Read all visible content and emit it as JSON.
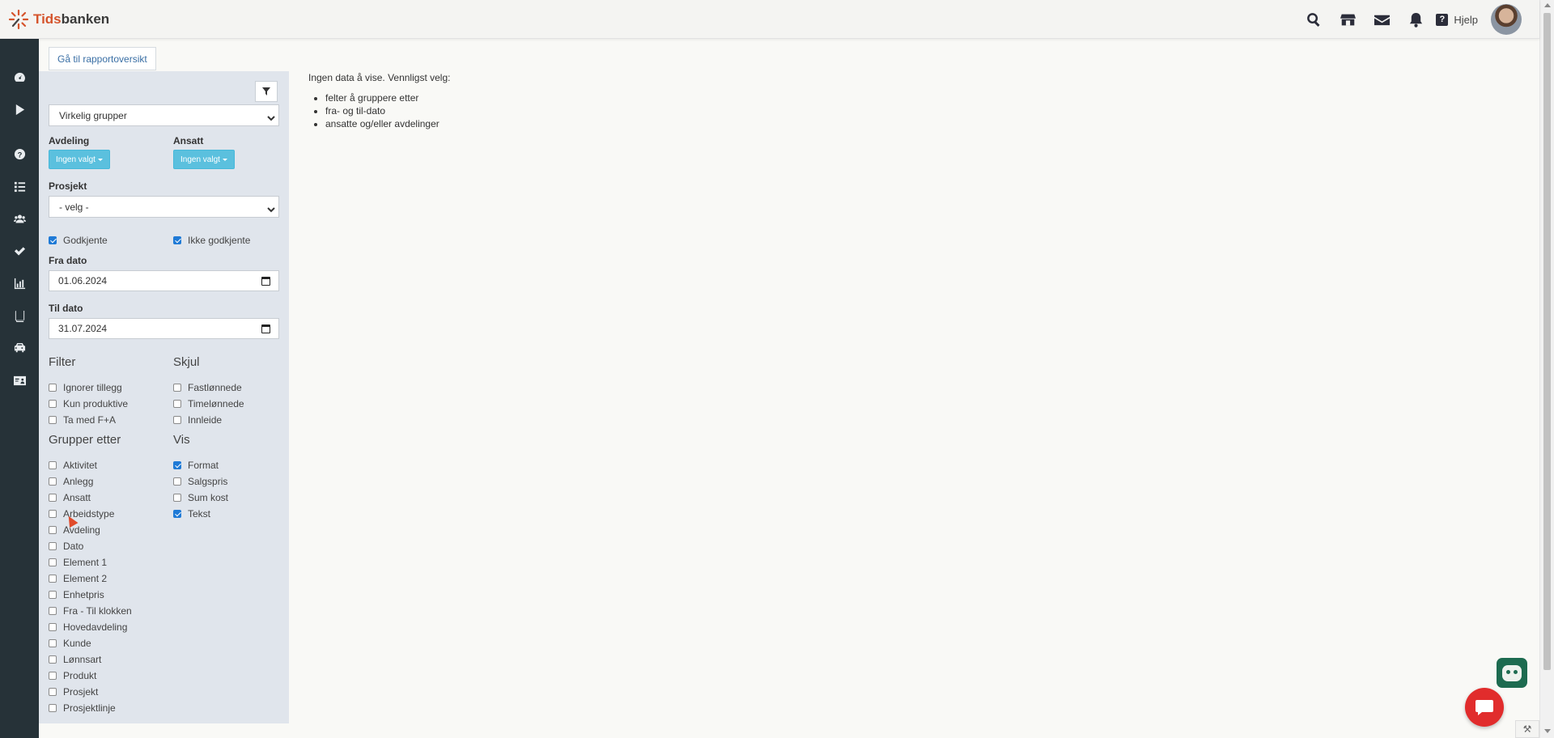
{
  "app": {
    "logo_text_a": "Tids",
    "logo_text_b": "banken",
    "brand_color": "#d5542c"
  },
  "topbar": {
    "icons": [
      "search-icon",
      "store-icon",
      "mail-icon",
      "bell-icon"
    ],
    "help_label": "Hjelp"
  },
  "nav": {
    "items": [
      "dashboard-icon",
      "play-icon",
      "question-icon",
      "list-icon",
      "users-icon",
      "check-icon",
      "chart-icon",
      "book-icon",
      "car-icon",
      "id-card-icon"
    ],
    "background": "#263238"
  },
  "report_button_label": "Gå til rapportoversikt",
  "panel": {
    "group_select_value": "Virkelig grupper",
    "avdeling_label": "Avdeling",
    "avdeling_button": "Ingen valgt",
    "ansatt_label": "Ansatt",
    "ansatt_button": "Ingen valgt",
    "prosjekt_label": "Prosjekt",
    "prosjekt_select_value": "- velg -",
    "godkjente_label": "Godkjente",
    "ikke_godkjente_label": "Ikke godkjente",
    "fra_dato_label": "Fra dato",
    "fra_dato_value": "01.06.2024",
    "til_dato_label": "Til dato",
    "til_dato_value": "31.07.2024",
    "filter_title": "Filter",
    "filter_items": [
      "Ignorer tillegg",
      "Kun produktive",
      "Ta med F+A"
    ],
    "skjul_title": "Skjul",
    "skjul_items": [
      "Fastlønnede",
      "Timelønnede",
      "Innleide"
    ],
    "grupper_title": "Grupper etter",
    "grupper_items": [
      "Aktivitet",
      "Anlegg",
      "Ansatt",
      "Arbeidstype",
      "Avdeling",
      "Dato",
      "Element 1",
      "Element 2",
      "Enhetpris",
      "Fra - Til klokken",
      "Hovedavdeling",
      "Kunde",
      "Lønnsart",
      "Produkt",
      "Prosjekt",
      "Prosjektlinje"
    ],
    "vis_title": "Vis",
    "vis_items": [
      "Format",
      "Salgspris",
      "Sum kost",
      "Tekst"
    ]
  },
  "main": {
    "message": "Ingen data å vise. Vennligst velg:",
    "bullets": [
      "felter å gruppere etter",
      "fra- og til-dato",
      "ansatte og/eller avdelinger"
    ]
  }
}
